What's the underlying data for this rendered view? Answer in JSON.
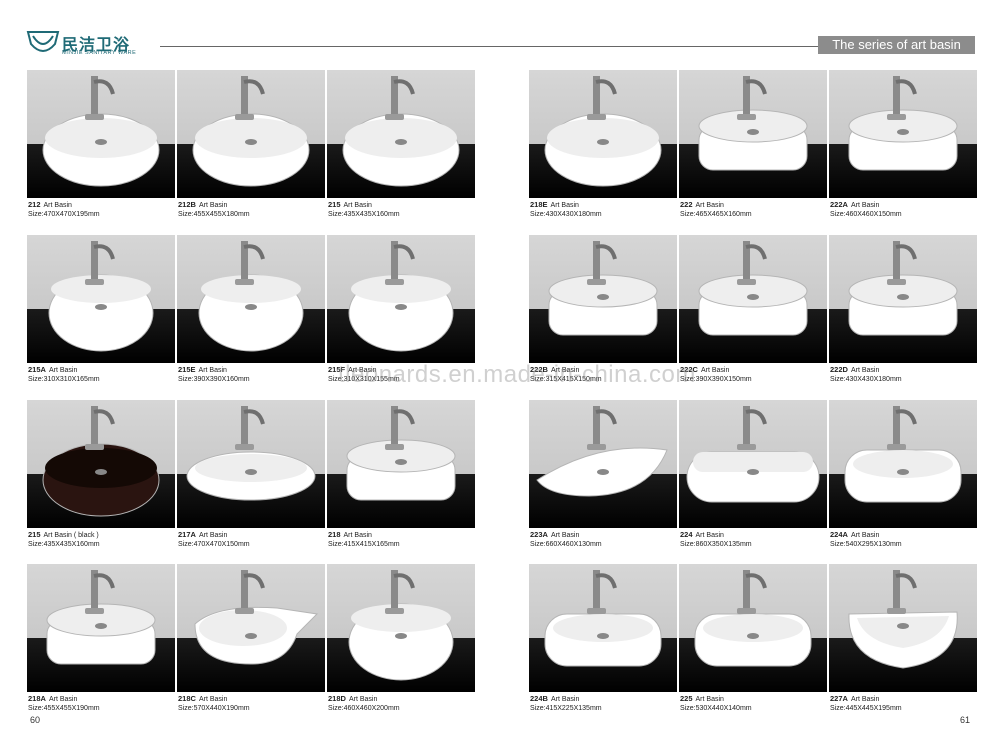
{
  "brand": {
    "name_cn": "民洁卫浴",
    "name_en": "MINJIE SANITARY WARE"
  },
  "header": {
    "series_title": "The series of art basin"
  },
  "watermark": "tleonards.en.made-in-china.com",
  "pages": {
    "left": "60",
    "right": "61"
  },
  "size_prefix": "Size:",
  "products": [
    {
      "code": "212",
      "name": "Art Basin",
      "size": "470X470X195mm",
      "shape": "bowl",
      "sink_color": "#ffffff"
    },
    {
      "code": "212B",
      "name": "Art Basin",
      "size": "455X455X180mm",
      "shape": "bowl",
      "sink_color": "#ffffff"
    },
    {
      "code": "215",
      "name": "Art Basin",
      "size": "435X435X160mm",
      "shape": "bowl",
      "sink_color": "#ffffff"
    },
    {
      "code": "218E",
      "name": "Art Basin",
      "size": "430X430X180mm",
      "shape": "bowl",
      "sink_color": "#ffffff"
    },
    {
      "code": "222",
      "name": "Art Basin",
      "size": "465X465X160mm",
      "shape": "round",
      "sink_color": "#ffffff"
    },
    {
      "code": "222A",
      "name": "Art Basin",
      "size": "460X460X150mm",
      "shape": "round",
      "sink_color": "#ffffff"
    },
    {
      "code": "215A",
      "name": "Art Basin",
      "size": "310X310X165mm",
      "shape": "deep",
      "sink_color": "#ffffff"
    },
    {
      "code": "215E",
      "name": "Art Basin",
      "size": "390X390X160mm",
      "shape": "deep",
      "sink_color": "#ffffff"
    },
    {
      "code": "215F",
      "name": "Art Basin",
      "size": "310X310X155mm",
      "shape": "deep",
      "sink_color": "#ffffff"
    },
    {
      "code": "222B",
      "name": "Art Basin",
      "size": "315X415X150mm",
      "shape": "round",
      "sink_color": "#ffffff"
    },
    {
      "code": "222C",
      "name": "Art Basin",
      "size": "390X390X150mm",
      "shape": "round",
      "sink_color": "#ffffff"
    },
    {
      "code": "222D",
      "name": "Art Basin",
      "size": "430X430X180mm",
      "shape": "round",
      "sink_color": "#ffffff"
    },
    {
      "code": "215",
      "name": "Art Basin ( black )",
      "size": "435X435X160mm",
      "shape": "bowl",
      "sink_color": "#2a1410"
    },
    {
      "code": "217A",
      "name": "Art Basin",
      "size": "470X470X150mm",
      "shape": "wide",
      "sink_color": "#ffffff"
    },
    {
      "code": "218",
      "name": "Art Basin",
      "size": "415X415X165mm",
      "shape": "round",
      "sink_color": "#ffffff"
    },
    {
      "code": "223A",
      "name": "Art Basin",
      "size": "660X460X130mm",
      "shape": "triangle",
      "sink_color": "#ffffff"
    },
    {
      "code": "224",
      "name": "Art Basin",
      "size": "860X350X135mm",
      "shape": "long",
      "sink_color": "#ffffff"
    },
    {
      "code": "224A",
      "name": "Art Basin",
      "size": "540X295X130mm",
      "shape": "oval",
      "sink_color": "#ffffff"
    },
    {
      "code": "218A",
      "name": "Art Basin",
      "size": "455X455X190mm",
      "shape": "round",
      "sink_color": "#ffffff"
    },
    {
      "code": "218C",
      "name": "Art Basin",
      "size": "570X440X190mm",
      "shape": "shelf",
      "sink_color": "#ffffff"
    },
    {
      "code": "218D",
      "name": "Art Basin",
      "size": "460X460X200mm",
      "shape": "deep",
      "sink_color": "#ffffff"
    },
    {
      "code": "224B",
      "name": "Art Basin",
      "size": "415X225X135mm",
      "shape": "oval",
      "sink_color": "#ffffff"
    },
    {
      "code": "225",
      "name": "Art Basin",
      "size": "530X440X140mm",
      "shape": "oval",
      "sink_color": "#ffffff"
    },
    {
      "code": "227A",
      "name": "Art Basin",
      "size": "445X445X195mm",
      "shape": "square",
      "sink_color": "#ffffff"
    }
  ]
}
